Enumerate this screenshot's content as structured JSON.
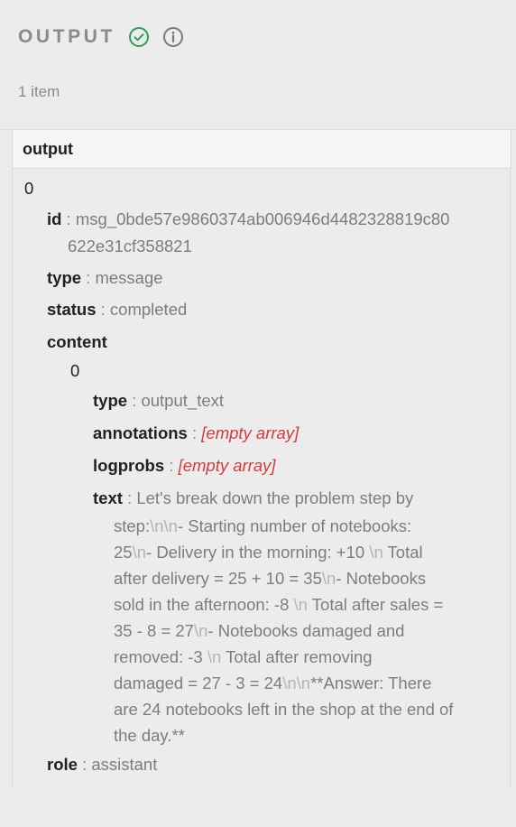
{
  "header": {
    "title": "OUTPUT",
    "status_icon": "check-circle-icon",
    "info_icon": "info-icon",
    "item_count": "1 item"
  },
  "column": {
    "label": "output"
  },
  "tree": {
    "root_index": "0",
    "id_key": "id",
    "id_value_line1": "msg_0bde57e9860374ab006946d4482328819c80",
    "id_value_line2": "622e31cf358821",
    "type_key": "type",
    "type_value": "message",
    "status_key": "status",
    "status_value": "completed",
    "content_key": "content",
    "content_index": "0",
    "c_type_key": "type",
    "c_type_value": "output_text",
    "annotations_key": "annotations",
    "annotations_value": "[empty array]",
    "logprobs_key": "logprobs",
    "logprobs_value": "[empty array]",
    "text_key": "text",
    "text_lines": [
      "Let's break down the problem step by",
      "step:\\n\\n- Starting number of notebooks:",
      "25\\n- Delivery in the morning: +10 \\n Total",
      "after delivery = 25 + 10 = 35\\n- Notebooks",
      "sold in the afternoon: -8 \\n Total after sales =",
      "35 - 8 = 27\\n- Notebooks damaged and",
      "removed: -3 \\n Total after removing",
      "damaged = 27 - 3 = 24\\n\\n**Answer: There",
      "are 24 notebooks left in the shop at the end of",
      "the day.**"
    ],
    "role_key": "role",
    "role_value": "assistant"
  },
  "colors": {
    "check": "#2e9f5b",
    "info": "#7a7a7a",
    "empty_array": "#d43b3b"
  }
}
